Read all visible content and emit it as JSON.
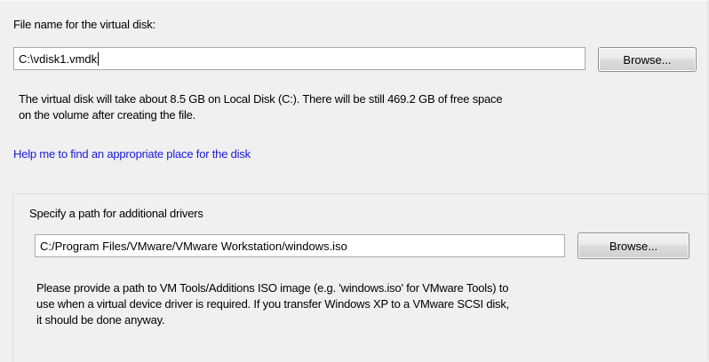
{
  "disk": {
    "file_label": "File name for the virtual disk:",
    "file_value": "C:\\vdisk1.vmdk",
    "browse_label": "Browse...",
    "info_line1": "The virtual disk will take about 8.5 GB on Local Disk (C:). There will be still 469.2 GB of free space",
    "info_line2": "on the volume after creating the file.",
    "help_link": "Help me to find an appropriate place for the disk"
  },
  "drivers": {
    "group_title": "Specify a path for additional drivers",
    "path_value": "C:/Program Files/VMware/VMware Workstation/windows.iso",
    "browse_label": "Browse...",
    "info_line1": "Please provide a path to VM Tools/Additions ISO image (e.g. 'windows.iso' for VMware Tools) to",
    "info_line2": "use when a virtual device driver is required. If you transfer Windows XP to a VMware SCSI disk,",
    "info_line3": "it should be done anyway."
  },
  "colors": {
    "link": "#1a1ad8",
    "background": "#f0f0f0"
  }
}
